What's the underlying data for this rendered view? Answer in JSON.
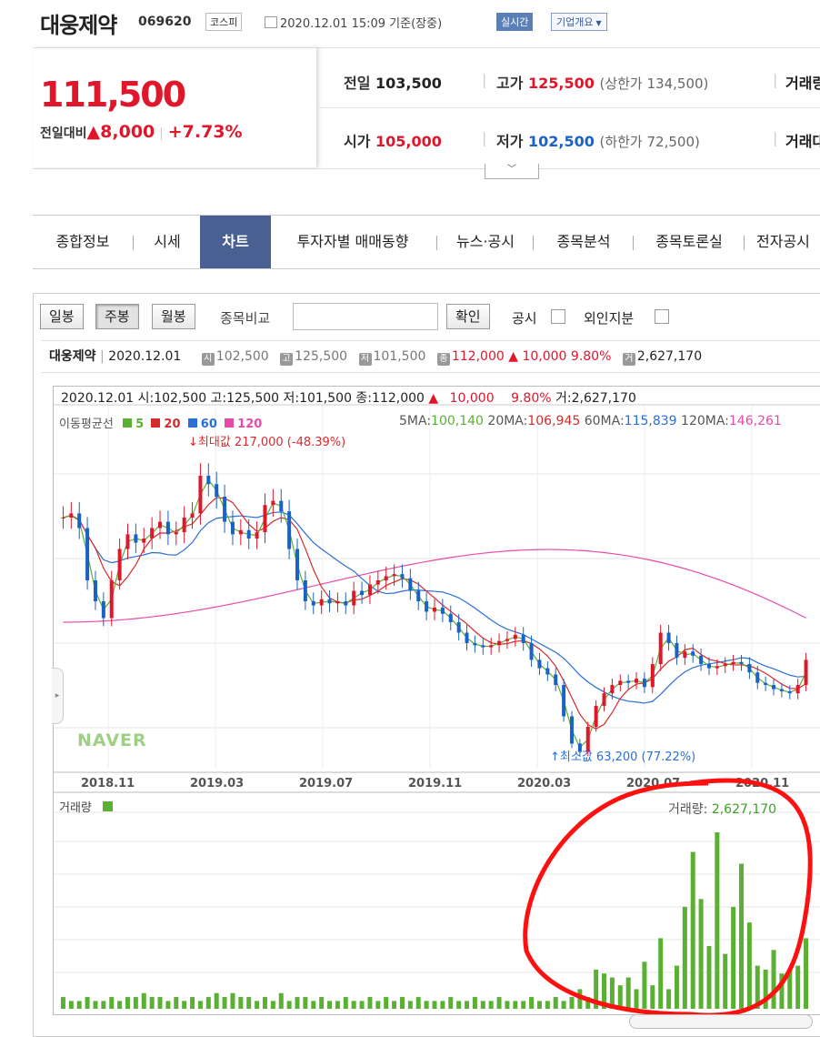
{
  "header": {
    "company": "대웅제약",
    "code": "069620",
    "market_badge": "코스피",
    "date_text": "2020.12.01 15:09 기준(장중)",
    "realtime_label": "실시간",
    "corp_overview_label": "기업개요"
  },
  "price": {
    "current": "111,500",
    "change_label": "전일대비",
    "change_arrow": "▲",
    "change_amount": "8,000",
    "change_pct": "+7.73%",
    "prev_label": "전일",
    "prev_value": "103,500",
    "high_label": "고가",
    "high_value": "125,500",
    "upper_limit": "(상한가 134,500)",
    "volume_label_partial": "거래량",
    "open_label": "시가",
    "open_value": "105,000",
    "low_label": "저가",
    "low_value": "102,500",
    "lower_limit": "(하한가 72,500)",
    "amount_label_partial": "거래대",
    "expand_icon": "chevron-down-icon"
  },
  "tabs": [
    {
      "label": "종합정보"
    },
    {
      "label": "시세"
    },
    {
      "label": "차트"
    },
    {
      "label": "투자자별 매매동향"
    },
    {
      "label": "뉴스·공시"
    },
    {
      "label": "종목분석"
    },
    {
      "label": "종목토론실"
    },
    {
      "label": "전자공시"
    }
  ],
  "toolbar": {
    "daily": "일봉",
    "weekly": "주봉",
    "monthly": "월봉",
    "compare_label": "종목비교",
    "confirm": "확인",
    "disclosure_label": "공시",
    "foreign_label": "외인지분"
  },
  "infobar": {
    "name": "대웅제약",
    "date": "2020.12.01",
    "open_icon": "시",
    "open": "102,500",
    "high_icon": "고",
    "high": "125,500",
    "low_icon": "저",
    "low": "101,500",
    "close_icon": "종",
    "close": "112,000",
    "arrow": "▲",
    "change": "10,000",
    "pct": "9.80%",
    "vol_icon": "거",
    "volume": "2,627,170"
  },
  "chart_header": {
    "line": "2020.12.01 시:102,500 고:125,500 저:101,500 종:112,000",
    "arrow": "▲",
    "change": "10,000",
    "pct": "9.80%",
    "vol": "거:2,627,170"
  },
  "ma_legend": {
    "label": "이동평균선",
    "items": [
      {
        "name": "5",
        "color": "#5ab033"
      },
      {
        "name": "20",
        "color": "#d52b2b"
      },
      {
        "name": "60",
        "color": "#2a6fd6"
      },
      {
        "name": "120",
        "color": "#e94aa8"
      }
    ],
    "ma5_label": "5MA:",
    "ma5": "100,140",
    "ma20_label": "20MA:",
    "ma20": "106,945",
    "ma60_label": "60MA:",
    "ma60": "115,839",
    "ma120_label": "120MA:",
    "ma120": "146,261"
  },
  "annotations": {
    "max_text": "최대값 217,000 (-48.39%)",
    "min_text": "최소값 63,200 (77.22%)",
    "watermark": "NAVER"
  },
  "volume_panel": {
    "label": "거래량",
    "value_label": "거래량:",
    "value": "2,627,170",
    "color": "#5ab033"
  },
  "chart_data": {
    "type": "candlestick",
    "x_ticks": [
      "2018.11",
      "2019.03",
      "2019.07",
      "2019.11",
      "2020.03",
      "2020.07",
      "2020.11"
    ],
    "close": [
      180000,
      182000,
      175000,
      150000,
      140000,
      132000,
      150000,
      165000,
      172000,
      168000,
      170000,
      175000,
      178000,
      172000,
      173000,
      180000,
      182000,
      200000,
      196000,
      190000,
      178000,
      172000,
      174000,
      170000,
      173000,
      186000,
      188000,
      183000,
      165000,
      150000,
      140000,
      138000,
      141000,
      139000,
      140000,
      138000,
      145000,
      143000,
      148000,
      150000,
      152000,
      153000,
      151000,
      145000,
      140000,
      135000,
      137000,
      134000,
      130000,
      125000,
      120000,
      119000,
      118000,
      119000,
      121000,
      122000,
      124000,
      120000,
      112000,
      108000,
      105000,
      100000,
      85000,
      72000,
      68000,
      80000,
      90000,
      96000,
      100000,
      102000,
      101000,
      103000,
      99000,
      110000,
      125000,
      120000,
      113000,
      116000,
      114000,
      110000,
      108000,
      109000,
      110000,
      111000,
      110000,
      106000,
      101000,
      100000,
      98000,
      97000,
      96000,
      100000,
      112000
    ],
    "volume": [
      3,
      2,
      2,
      3,
      2,
      2,
      3,
      2,
      3,
      3,
      4,
      3,
      3,
      2,
      3,
      2,
      3,
      2,
      3,
      4,
      3,
      4,
      3,
      3,
      2,
      3,
      2,
      4,
      2,
      3,
      3,
      2,
      3,
      2,
      2,
      3,
      2,
      2,
      3,
      2,
      3,
      2,
      3,
      2,
      3,
      2,
      2,
      2,
      3,
      2,
      2,
      3,
      2,
      2,
      3,
      2,
      2,
      2,
      3,
      2,
      2,
      3,
      2,
      3,
      5,
      3,
      10,
      9,
      8,
      6,
      8,
      5,
      12,
      6,
      18,
      5,
      11,
      26,
      40,
      28,
      16,
      45,
      14,
      26,
      37,
      22,
      11,
      10,
      15,
      9,
      10,
      11,
      18
    ],
    "volume_unit_note": "",
    "ma_summary": {
      "ma5": 100140,
      "ma20": 106945,
      "ma60": 115839,
      "ma120": 146261
    },
    "max": 217000,
    "min": 63200
  }
}
